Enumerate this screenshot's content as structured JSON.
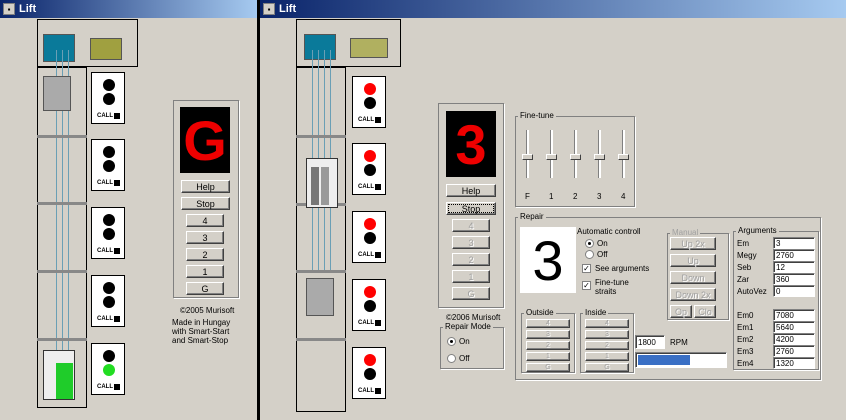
{
  "window_left": {
    "title": "Lift",
    "display_floor": "G",
    "buttons": {
      "help": "Help",
      "stop": "Stop",
      "floors": [
        "4",
        "3",
        "2",
        "1",
        "G"
      ]
    },
    "call_label": "CALL",
    "credits": {
      "copyright": "©2005 Murisoft",
      "line1": "Made in Hungay",
      "line2": "with Smart-Start",
      "line3": "and Smart-Stop"
    }
  },
  "window_right": {
    "title": "Lift",
    "display_floor": "3",
    "buttons": {
      "help": "Help",
      "stop": "Stop",
      "floors": [
        "4",
        "3",
        "2",
        "1",
        "G"
      ]
    },
    "call_label": "CALL",
    "copyright": "©2006 Murisoft",
    "repair_mode": {
      "label": "Repair Mode",
      "on": "On",
      "off": "Off",
      "selected": "On"
    },
    "fine_tune": {
      "label": "Fine-tune",
      "sliders": [
        "F",
        "1",
        "2",
        "3",
        "4"
      ]
    },
    "repair": {
      "label": "Repair",
      "big_digit": "3",
      "auto_label": "Automatic controll",
      "on": "On",
      "off": "Off",
      "see_arguments": "See arguments",
      "fine_tune_straits": "Fine-tune straits",
      "manual": {
        "label": "Manual",
        "up2x": "Up 2x",
        "up": "Up",
        "down": "Down",
        "down2x": "Down 2x",
        "op": "Op",
        "clo": "Clo"
      },
      "outside": {
        "label": "Outside",
        "floors": [
          "4",
          "3",
          "2",
          "1",
          "G"
        ]
      },
      "inside": {
        "label": "Inside",
        "floors": [
          "4",
          "3",
          "2",
          "1",
          "G"
        ]
      },
      "rpm_value": "1800",
      "rpm_label": "RPM",
      "rpm_progress": 0.6
    },
    "arguments": {
      "label": "Arguments",
      "rows": [
        {
          "name": "Em",
          "value": "3"
        },
        {
          "name": "Megy",
          "value": "2760"
        },
        {
          "name": "Seb",
          "value": "12"
        },
        {
          "name": "Zar",
          "value": "360"
        },
        {
          "name": "AutoVez",
          "value": "0"
        }
      ],
      "rows2": [
        {
          "name": "Em0",
          "value": "7080"
        },
        {
          "name": "Em1",
          "value": "5640"
        },
        {
          "name": "Em2",
          "value": "4200"
        },
        {
          "name": "Em3",
          "value": "2760"
        },
        {
          "name": "Em4",
          "value": "1320"
        }
      ]
    }
  },
  "colors": {
    "title_active": "#0a246a",
    "display_text": "#ee0000",
    "lamp_red": "#ff0000",
    "lamp_green": "#22dd22",
    "rpm_bar": "#3a6fc4"
  }
}
